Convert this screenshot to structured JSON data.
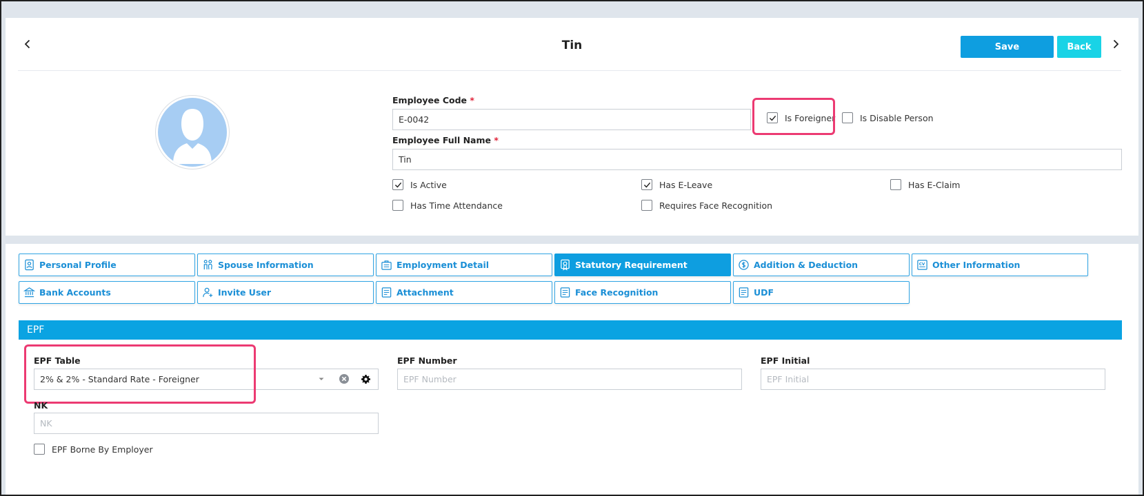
{
  "header": {
    "title": "Tin",
    "save_label": "Save",
    "back_label": "Back"
  },
  "profile": {
    "employee_code_label": "Employee Code",
    "employee_code_value": "E-0042",
    "full_name_label": "Employee Full Name",
    "full_name_value": "Tin",
    "required_mark": "*",
    "checkboxes": {
      "is_foreigner": {
        "label": "Is Foreigner",
        "checked": true
      },
      "is_disable_person": {
        "label": "Is Disable Person",
        "checked": false
      },
      "is_active": {
        "label": "Is Active",
        "checked": true
      },
      "has_e_leave": {
        "label": "Has E-Leave",
        "checked": true
      },
      "has_e_claim": {
        "label": "Has E-Claim",
        "checked": false
      },
      "has_time_attendance": {
        "label": "Has Time Attendance",
        "checked": false
      },
      "requires_face_recognition": {
        "label": "Requires Face Recognition",
        "checked": false
      }
    }
  },
  "tabs": [
    {
      "label": "Personal Profile",
      "icon": "profile-icon"
    },
    {
      "label": "Spouse Information",
      "icon": "couple-icon"
    },
    {
      "label": "Employment Detail",
      "icon": "briefcase-icon"
    },
    {
      "label": "Statutory Requirement",
      "icon": "certificate-icon",
      "active": true
    },
    {
      "label": "Addition & Deduction",
      "icon": "money-icon"
    },
    {
      "label": "Other Information",
      "icon": "cv-icon"
    },
    {
      "label": "Bank Accounts",
      "icon": "bank-icon"
    },
    {
      "label": "Invite User",
      "icon": "add-user-icon"
    },
    {
      "label": "Attachment",
      "icon": "document-icon"
    },
    {
      "label": "Face Recognition",
      "icon": "document-icon"
    },
    {
      "label": "UDF",
      "icon": "document-icon"
    }
  ],
  "epf": {
    "section_title": "EPF",
    "table_label": "EPF Table",
    "table_value": "2% & 2% - Standard Rate - Foreigner",
    "number_label": "EPF Number",
    "number_placeholder": "EPF Number",
    "initial_label": "EPF Initial",
    "initial_placeholder": "EPF Initial",
    "nk_label": "NK",
    "nk_placeholder": "NK",
    "borne_by_employer": {
      "label": "EPF Borne By Employer",
      "checked": false
    }
  },
  "colors": {
    "accent": "#0e9ee0",
    "back_button": "#19d3e6",
    "highlight": "#ec3a72",
    "required": "#e0243a"
  }
}
